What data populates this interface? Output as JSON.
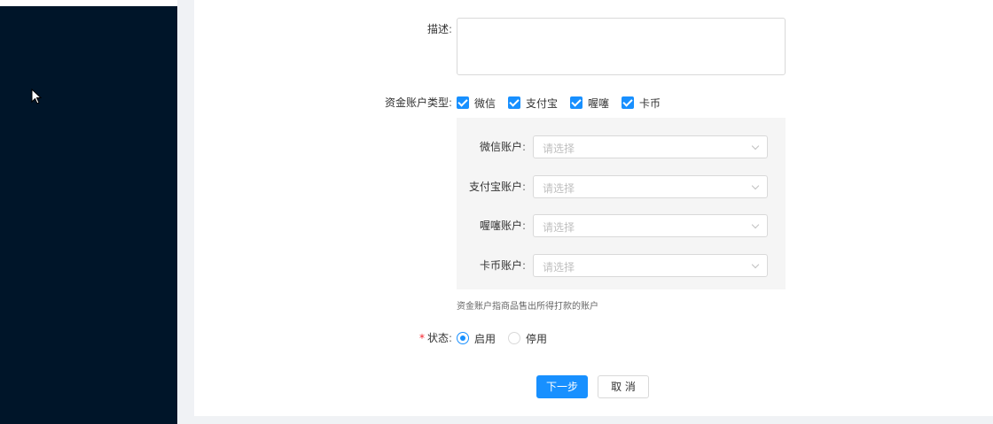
{
  "form": {
    "description_label": "描述",
    "fund_account_type_label": "资金账户类型",
    "account_types": [
      {
        "label": "微信",
        "checked": true
      },
      {
        "label": "支付宝",
        "checked": true
      },
      {
        "label": "喔噻",
        "checked": true
      },
      {
        "label": "卡币",
        "checked": true
      }
    ],
    "accounts": [
      {
        "label": "微信账户",
        "placeholder": "请选择"
      },
      {
        "label": "支付宝账户",
        "placeholder": "请选择"
      },
      {
        "label": "喔噻账户",
        "placeholder": "请选择"
      },
      {
        "label": "卡币账户",
        "placeholder": "请选择"
      }
    ],
    "hint": "资金账户指商品售出所得打款的账户",
    "status_required_mark": "*",
    "status_label": "状态",
    "status_options": [
      {
        "label": "启用",
        "selected": true
      },
      {
        "label": "停用",
        "selected": false
      }
    ],
    "next_button": "下一步",
    "cancel_button": "取 消"
  },
  "colors": {
    "sidebar": "#001529",
    "primary": "#1890ff",
    "required": "#f5222d"
  }
}
